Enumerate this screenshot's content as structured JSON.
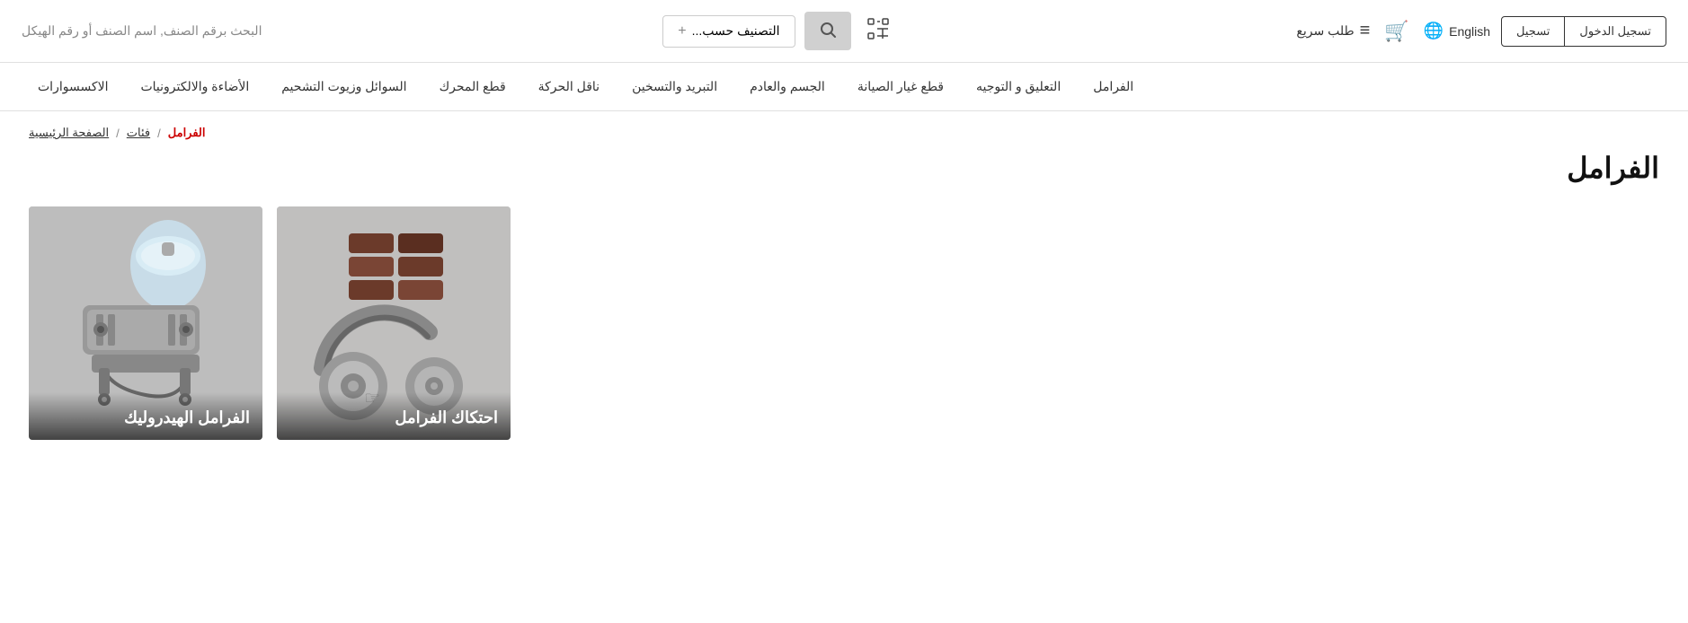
{
  "header": {
    "search_placeholder": "البحث برقم الصنف, اسم الصنف أو رقم الهيكل",
    "classify_label": "التصنيف حسب...",
    "classify_plus": "+",
    "scan_label": "مسح",
    "quick_order_label": "طلب سريع",
    "cart_label": "سلة",
    "language_label": "English",
    "login_label": "تسجيل",
    "register_label": "تسجيل الدخول"
  },
  "nav": {
    "items": [
      "الفرامل",
      "التعليق و التوجيه",
      "قطع غيار الصيانة",
      "الجسم والعادم",
      "التبريد والتسخين",
      "ناقل الحركة",
      "قطع المحرك",
      "السوائل وزيوت التشحيم",
      "الأضاءة والالكترونيات",
      "الاكسسوارات"
    ]
  },
  "breadcrumb": {
    "home": "الصفحة الرئيسية",
    "categories": "فئات",
    "current": "الفرامل",
    "sep1": "/",
    "sep2": "/"
  },
  "page": {
    "title": "الفرامل"
  },
  "categories": [
    {
      "id": "brake-friction",
      "label": "احتكاك الفرامل",
      "color1": "#b5b5b5",
      "color2": "#cccccc"
    },
    {
      "id": "hydraulic-brakes",
      "label": "الفرامل الهيدروليك",
      "color1": "#c0c0c0",
      "color2": "#d5d5d5"
    }
  ]
}
